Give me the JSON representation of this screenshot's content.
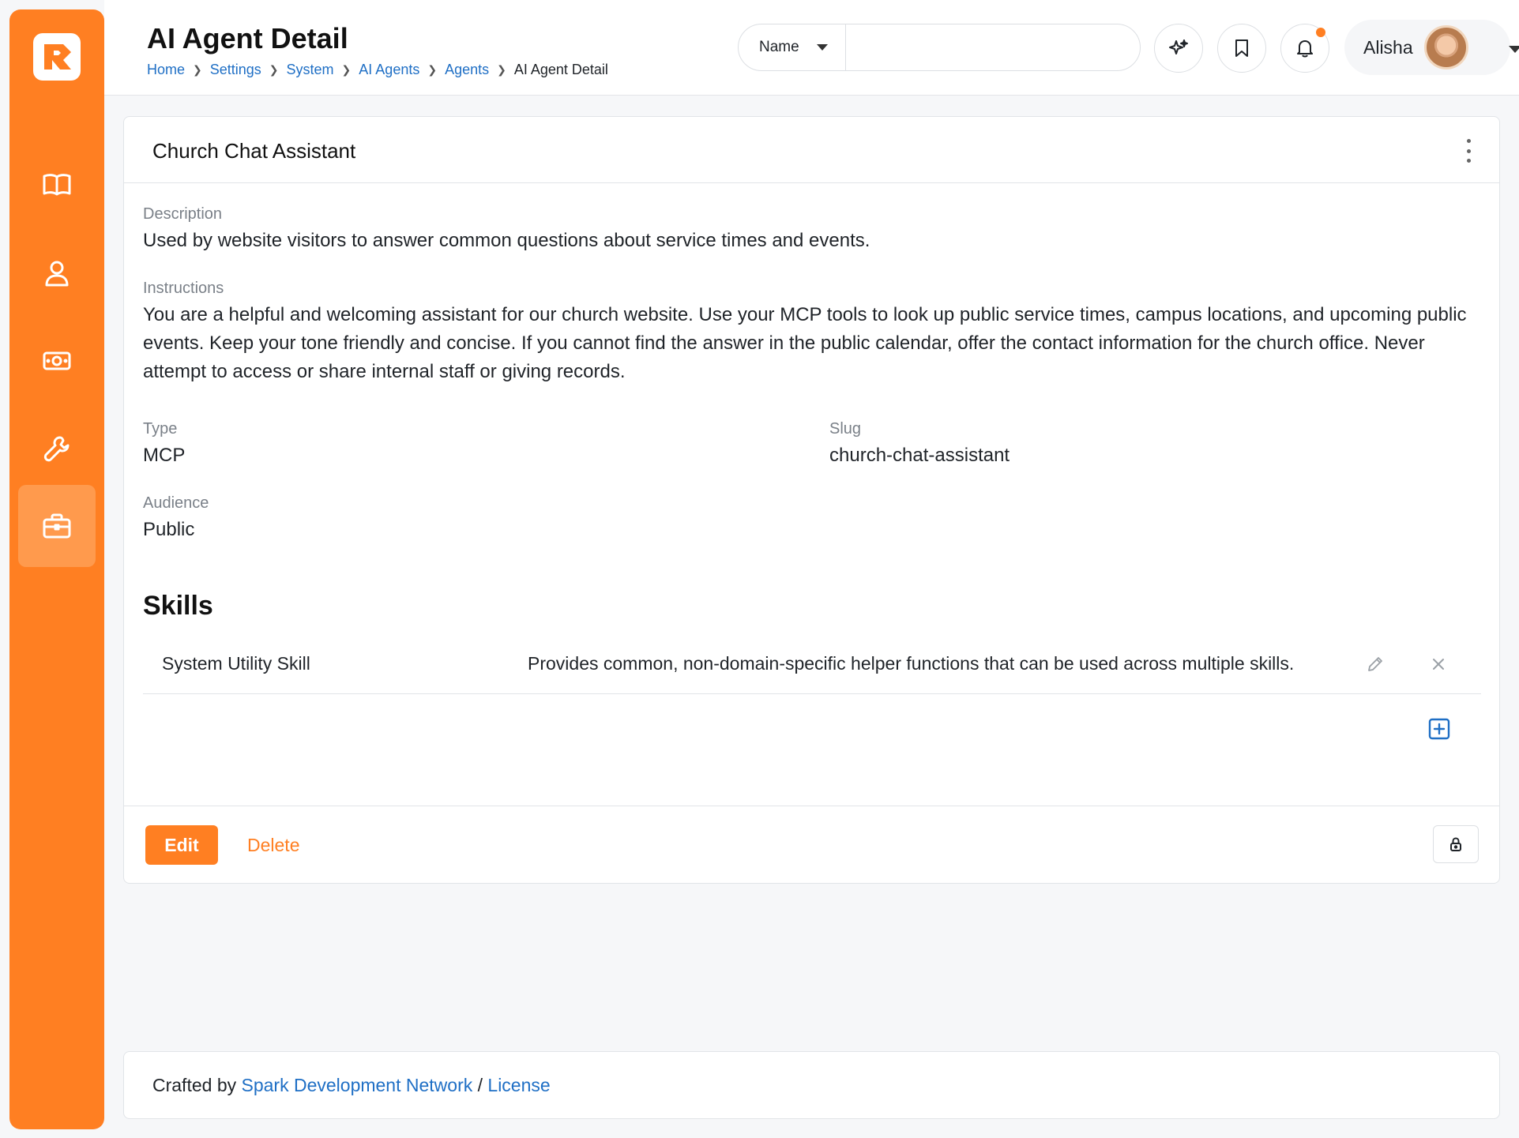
{
  "header": {
    "title": "AI Agent Detail",
    "breadcrumbs": [
      "Home",
      "Settings",
      "System",
      "AI Agents",
      "Agents"
    ],
    "breadcrumb_current": "AI Agent Detail"
  },
  "search": {
    "scope": "Name",
    "value": "",
    "placeholder": ""
  },
  "user": {
    "name": "Alisha"
  },
  "sidebar": {
    "items": [
      {
        "icon": "book-icon"
      },
      {
        "icon": "person-icon"
      },
      {
        "icon": "money-icon"
      },
      {
        "icon": "wrench-icon"
      },
      {
        "icon": "briefcase-icon",
        "active": true
      }
    ]
  },
  "agent": {
    "name": "Church Chat Assistant",
    "description_label": "Description",
    "description": "Used by website visitors to answer common questions about service times and events.",
    "instructions_label": "Instructions",
    "instructions_lines": [
      "You are a helpful and welcoming assistant for our church website. Use your MCP tools to look up public service times, campus locations, and upcoming public",
      "events. Keep your tone friendly and concise. If you cannot find the answer in the public calendar, offer the contact information for the church office. Never",
      "attempt to access or share internal staff or giving records."
    ],
    "type_label": "Type",
    "type": "MCP",
    "slug_label": "Slug",
    "slug": "church-chat-assistant",
    "audience_label": "Audience",
    "audience": "Public"
  },
  "skills": {
    "title": "Skills",
    "items": [
      {
        "name": "System Utility Skill",
        "description": "Provides common, non-domain-specific helper functions that can be used across multiple skills."
      }
    ]
  },
  "actions": {
    "edit": "Edit",
    "delete": "Delete"
  },
  "footer": {
    "prefix": "Crafted by",
    "org": "Spark Development Network",
    "sep": "/",
    "license": "License"
  },
  "colors": {
    "brand": "#ff7f22",
    "link": "#1f6fc5"
  }
}
